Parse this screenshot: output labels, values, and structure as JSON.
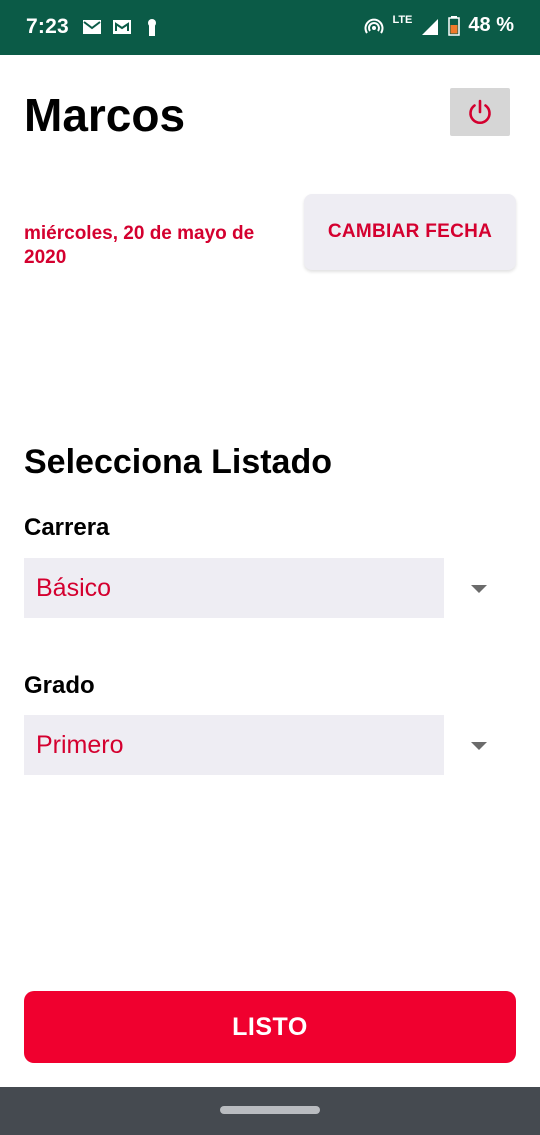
{
  "status_bar": {
    "time": "7:23",
    "network": "LTE",
    "battery": "48 %",
    "left_icons": [
      "mail-icon",
      "gmail-icon",
      "keyhole-icon"
    ],
    "right_icons": [
      "hotspot-icon",
      "signal-icon",
      "battery-icon"
    ]
  },
  "header": {
    "title": "Marcos",
    "power_icon": "power-icon"
  },
  "date": {
    "text": "miércoles, 20 de mayo de 2020",
    "change_label": "CAMBIAR FECHA"
  },
  "form": {
    "section_title": "Selecciona Listado",
    "career_label": "Carrera",
    "career_value": "Básico",
    "grade_label": "Grado",
    "grade_value": "Primero"
  },
  "actions": {
    "done_label": "LISTO"
  },
  "colors": {
    "status_bar": "#0b5b47",
    "accent_red": "#d4002f",
    "button_red": "#f0002f",
    "field_bg": "#eeedf3",
    "nav_bar": "#454a50"
  }
}
